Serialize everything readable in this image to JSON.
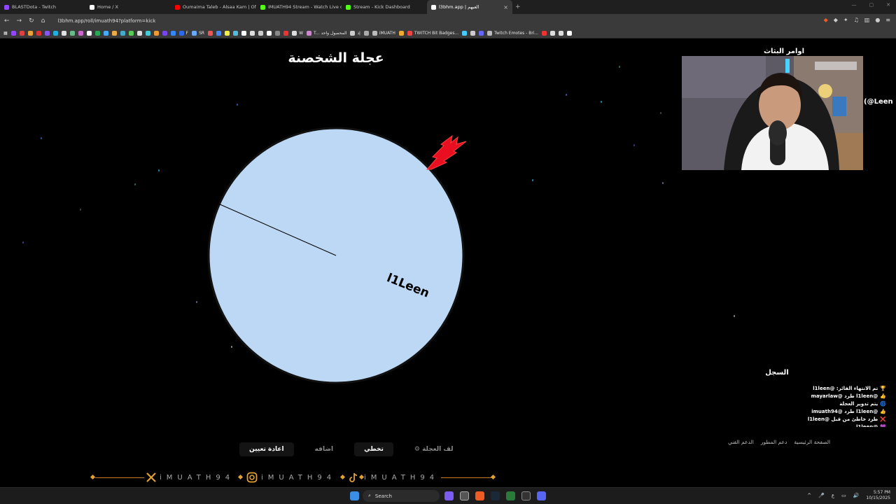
{
  "browser": {
    "tabs": [
      {
        "label": "BLASTDota - Twitch",
        "color": "#9146ff"
      },
      {
        "label": "Home / X",
        "color": "#ffffff"
      },
      {
        "label": "Oumaima Taleb - Alsaa Kam | Of",
        "color": "#ff0000"
      },
      {
        "label": "iMUATH94 Stream - Watch Live o",
        "color": "#53fc18"
      },
      {
        "label": "Stream - Kick Dashboard",
        "color": "#53fc18"
      },
      {
        "label": "l3bhm.app | العبهم",
        "color": "#ffffff",
        "active": true
      }
    ],
    "new_tab": "+",
    "url": "l3bhm.app/roll/imuath94?platform=kick",
    "bookmarks": [
      {
        "label": "",
        "color": "#9146ff"
      },
      {
        "label": "",
        "color": "#e04040"
      },
      {
        "label": "",
        "color": "#f0a030"
      },
      {
        "label": "",
        "color": "#e03030"
      },
      {
        "label": "",
        "color": "#8855ee"
      },
      {
        "label": "",
        "color": "#20b0e0"
      },
      {
        "label": "",
        "color": "#e0e0e0"
      },
      {
        "label": "",
        "color": "#6b8"
      },
      {
        "label": "",
        "color": "#c6c"
      },
      {
        "label": "",
        "color": "#fff"
      },
      {
        "label": "",
        "color": "#2a5"
      },
      {
        "label": "",
        "color": "#4af"
      },
      {
        "label": "",
        "color": "#ea4"
      },
      {
        "label": "",
        "color": "#4ac"
      },
      {
        "label": "",
        "color": "#5c5"
      },
      {
        "label": "",
        "color": "#ddd"
      },
      {
        "label": "",
        "color": "#4cd"
      },
      {
        "label": "",
        "color": "#e93"
      },
      {
        "label": "",
        "color": "#74e"
      },
      {
        "label": "",
        "color": "#38f"
      },
      {
        "label": "F",
        "color": "#2a6af0"
      },
      {
        "label": "SR",
        "color": "#6af"
      },
      {
        "label": "",
        "color": "#e55"
      },
      {
        "label": "",
        "color": "#48f"
      },
      {
        "label": "",
        "color": "#ee4"
      },
      {
        "label": "",
        "color": "#5bd"
      },
      {
        "label": "",
        "color": "#fff"
      },
      {
        "label": "",
        "color": "#ddd"
      },
      {
        "label": "",
        "color": "#ccc"
      },
      {
        "label": "",
        "color": "#fff"
      },
      {
        "label": "",
        "color": "#888"
      },
      {
        "label": "",
        "color": "#e33"
      },
      {
        "label": "W",
        "color": "#ddd"
      },
      {
        "label": "T... المحصول واحد",
        "color": "#c8c"
      },
      {
        "label": "إذ",
        "color": "#ccc"
      },
      {
        "label": "",
        "color": "#aaa"
      },
      {
        "label": "iMUATH",
        "color": "#bbb"
      },
      {
        "label": "",
        "color": "#ea3"
      },
      {
        "label": "TWITCH Bit Badges...",
        "color": "#e44"
      },
      {
        "label": "",
        "color": "#4cf"
      },
      {
        "label": "",
        "color": "#ccc"
      },
      {
        "label": "",
        "color": "#66f"
      },
      {
        "label": "Twitch Emotes - Bri...",
        "color": "#bbb"
      },
      {
        "label": "",
        "color": "#e33"
      },
      {
        "label": "",
        "color": "#ddd"
      },
      {
        "label": "",
        "color": "#ddd"
      },
      {
        "label": "",
        "color": "#fff"
      }
    ]
  },
  "wheel": {
    "title": "عجلة الشخصنة",
    "entries": [
      {
        "name": "l1Leen"
      }
    ],
    "color": "#bcd8f4"
  },
  "stream": {
    "title": "اوامر البثاث",
    "side_text": "(@Leen"
  },
  "log": {
    "title": "السجل",
    "entries": [
      {
        "icon": "🏆",
        "text": "تم الانتهاء الفائز: @l1leen"
      },
      {
        "icon": "👍",
        "text": "@l1leen طرد @mayarlaw"
      },
      {
        "icon": "🌀",
        "text": "يتم تدوير العجلة"
      },
      {
        "icon": "👍",
        "text": "@l1leen طرد @imuath94"
      },
      {
        "icon": "❌",
        "text": "طرد خاطئ من قبل @l1leen"
      },
      {
        "icon": "💜",
        "text": "@l1leen ..."
      }
    ]
  },
  "controls": {
    "spin": "لف العجلة",
    "skip": "تخطي",
    "add": "اضافه",
    "reset": "اعادة تعيين"
  },
  "footer": {
    "links": [
      "الصفحة الرئيسية",
      "دعم المطور",
      "الدعم الفني"
    ]
  },
  "social": {
    "handle": "iMUATH94",
    "accent": "#c87c1e"
  },
  "taskbar": {
    "search": "Search",
    "time": "5:57 PM",
    "date": "10/15/2025",
    "lang": "ع"
  }
}
